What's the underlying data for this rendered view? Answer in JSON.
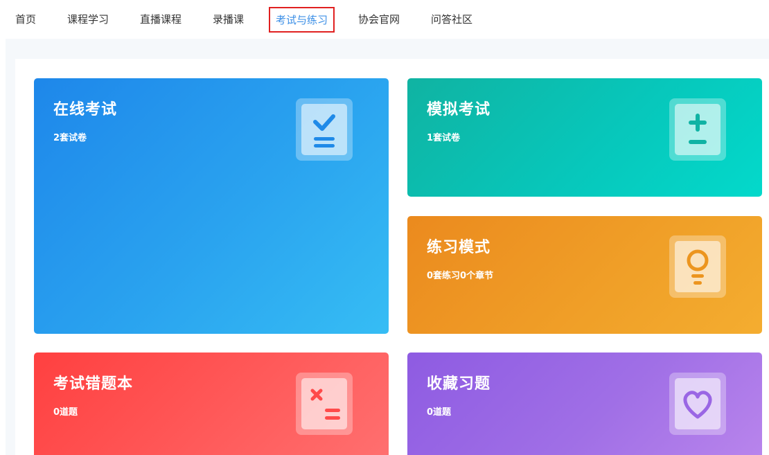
{
  "nav": {
    "items": [
      {
        "label": "首页"
      },
      {
        "label": "课程学习"
      },
      {
        "label": "直播课程"
      },
      {
        "label": "录播课"
      },
      {
        "label": "考试与练习",
        "active": true
      },
      {
        "label": "协会官网"
      },
      {
        "label": "问答社区"
      }
    ]
  },
  "cards": {
    "online": {
      "title": "在线考试",
      "subtitle": "2套试卷",
      "icon": "checkmark-doc-icon",
      "color": "#1e87ea"
    },
    "mock": {
      "title": "模拟考试",
      "subtitle": "1套试卷",
      "icon": "plus-minus-icon",
      "color": "#07c7bb"
    },
    "practice": {
      "title": "练习模式",
      "subtitle": "0套练习0个章节",
      "icon": "lightbulb-icon",
      "color": "#f0a028"
    },
    "wrong": {
      "title": "考试错题本",
      "subtitle": "0道题",
      "icon": "x-doc-icon",
      "color": "#ff5252"
    },
    "favorites": {
      "title": "收藏习题",
      "subtitle": "0道题",
      "icon": "heart-icon",
      "color": "#a06fe6"
    }
  },
  "colors": {
    "active_nav_border": "#e02020",
    "active_nav_text": "#3a8ee6",
    "page_bg": "#f5f8fb"
  }
}
